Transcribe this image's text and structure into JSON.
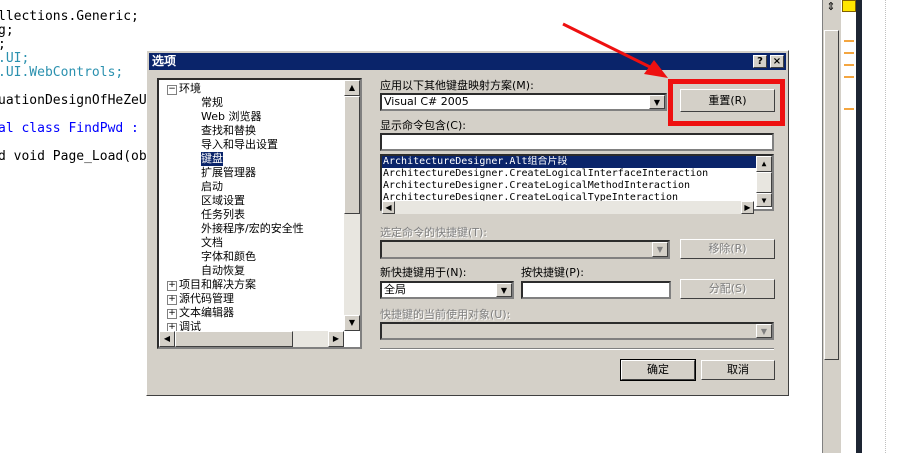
{
  "editor": {
    "lines": [
      "llections.Generic;",
      "g;",
      ";",
      ".UI;",
      ".UI.WebControls;",
      "",
      "uationDesignOfHeZeU",
      "al class FindPwd :",
      "",
      "d void Page_Load(ob"
    ]
  },
  "dialog": {
    "title": "选项",
    "help_btn": "?",
    "close_btn": "×",
    "tree": {
      "items": [
        {
          "label": "环境",
          "level": 0,
          "toggle": "−"
        },
        {
          "label": "常规",
          "level": 1
        },
        {
          "label": "Web 浏览器",
          "level": 1
        },
        {
          "label": "查找和替换",
          "level": 1
        },
        {
          "label": "导入和导出设置",
          "level": 1
        },
        {
          "label": "键盘",
          "level": 1,
          "selected": true
        },
        {
          "label": "扩展管理器",
          "level": 1
        },
        {
          "label": "启动",
          "level": 1
        },
        {
          "label": "区域设置",
          "level": 1
        },
        {
          "label": "任务列表",
          "level": 1
        },
        {
          "label": "外接程序/宏的安全性",
          "level": 1
        },
        {
          "label": "文档",
          "level": 1
        },
        {
          "label": "字体和颜色",
          "level": 1
        },
        {
          "label": "自动恢复",
          "level": 1
        },
        {
          "label": "项目和解决方案",
          "level": 0,
          "toggle": "+"
        },
        {
          "label": "源代码管理",
          "level": 0,
          "toggle": "+"
        },
        {
          "label": "文本编辑器",
          "level": 0,
          "toggle": "+"
        },
        {
          "label": "调试",
          "level": 0,
          "toggle": "+"
        }
      ]
    },
    "keyboard": {
      "mapping_label": "应用以下其他键盘映射方案(M):",
      "mapping_value": "Visual C# 2005",
      "reset_btn": "重置(R)",
      "commands_label": "显示命令包含(C):",
      "commands_filter": "",
      "commands": [
        "ArchitectureDesigner.Alt组合片段",
        "ArchitectureDesigner.CreateLogicalInterfaceInteraction",
        "ArchitectureDesigner.CreateLogicalMethodInteraction",
        "ArchitectureDesigner.CreateLogicalTypeInteraction"
      ],
      "shortcuts_label": "选定命令的快捷键(T):",
      "remove_btn": "移除(R)",
      "use_in_label": "新快捷键用于(N):",
      "use_in_value": "全局",
      "press_keys_label": "按快捷键(P):",
      "press_keys_value": "",
      "assign_btn": "分配(S)",
      "currently_used_label": "快捷键的当前使用对象(U):"
    },
    "ok_btn": "确定",
    "cancel_btn": "取消"
  }
}
